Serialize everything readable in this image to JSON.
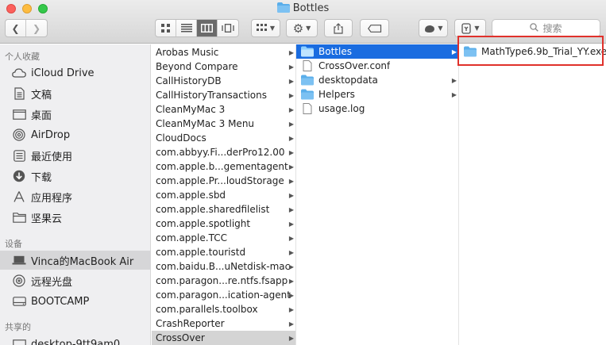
{
  "window": {
    "title": "Bottles"
  },
  "toolbar": {
    "back_icon": "chevron-left-icon",
    "forward_icon": "chevron-right-icon",
    "view_icons": [
      "icon-view-icon",
      "list-view-icon",
      "column-view-icon",
      "cover-flow-icon"
    ],
    "search_placeholder": "搜索"
  },
  "sidebar": {
    "favorites_heading": "个人收藏",
    "favorites": [
      {
        "label": "iCloud Drive",
        "icon": "cloud-icon"
      },
      {
        "label": "文稿",
        "icon": "document-icon"
      },
      {
        "label": "桌面",
        "icon": "desktop-icon"
      },
      {
        "label": "AirDrop",
        "icon": "airdrop-icon"
      },
      {
        "label": "最近使用",
        "icon": "recents-icon"
      },
      {
        "label": "下载",
        "icon": "download-icon"
      },
      {
        "label": "应用程序",
        "icon": "applications-icon"
      },
      {
        "label": "坚果云",
        "icon": "folder-icon"
      }
    ],
    "devices_heading": "设备",
    "devices": [
      {
        "label": "Vinca的MacBook Air",
        "icon": "laptop-icon"
      },
      {
        "label": "远程光盘",
        "icon": "disc-icon"
      },
      {
        "label": "BOOTCAMP",
        "icon": "drive-icon"
      }
    ],
    "shared_heading": "共享的",
    "shared": [
      {
        "label": "desktop-9tt9am0",
        "icon": "network-icon"
      }
    ]
  },
  "column1": {
    "items": [
      "Arobas Music",
      "Beyond Compare",
      "CallHistoryDB",
      "CallHistoryTransactions",
      "CleanMyMac 3",
      "CleanMyMac 3 Menu",
      "CloudDocs",
      "com.abbyy.Fi...derPro12.00",
      "com.apple.b...gementagent",
      "com.apple.Pr...loudStorage",
      "com.apple.sbd",
      "com.apple.sharedfilelist",
      "com.apple.spotlight",
      "com.apple.TCC",
      "com.apple.touristd",
      "com.baidu.B...uNetdisk-mac",
      "com.paragon...re.ntfs.fsapp",
      "com.paragon...ication-agent",
      "com.parallels.toolbox",
      "CrashReporter",
      "CrossOver"
    ],
    "selected": "CrossOver"
  },
  "column2": {
    "items": [
      {
        "label": "Bottles",
        "type": "folder",
        "has_children": true
      },
      {
        "label": "CrossOver.conf",
        "type": "file",
        "has_children": false
      },
      {
        "label": "desktopdata",
        "type": "folder",
        "has_children": true
      },
      {
        "label": "Helpers",
        "type": "folder",
        "has_children": true
      },
      {
        "label": "usage.log",
        "type": "file",
        "has_children": false
      }
    ],
    "selected": "Bottles"
  },
  "column3": {
    "items": [
      {
        "label": "MathType6.9b_Trial_YY.exe",
        "type": "folder",
        "has_children": false
      }
    ]
  },
  "colors": {
    "selection_blue": "#1a6ce0",
    "highlight_box": "#e0312b",
    "folder_blue": "#5aaeea"
  }
}
